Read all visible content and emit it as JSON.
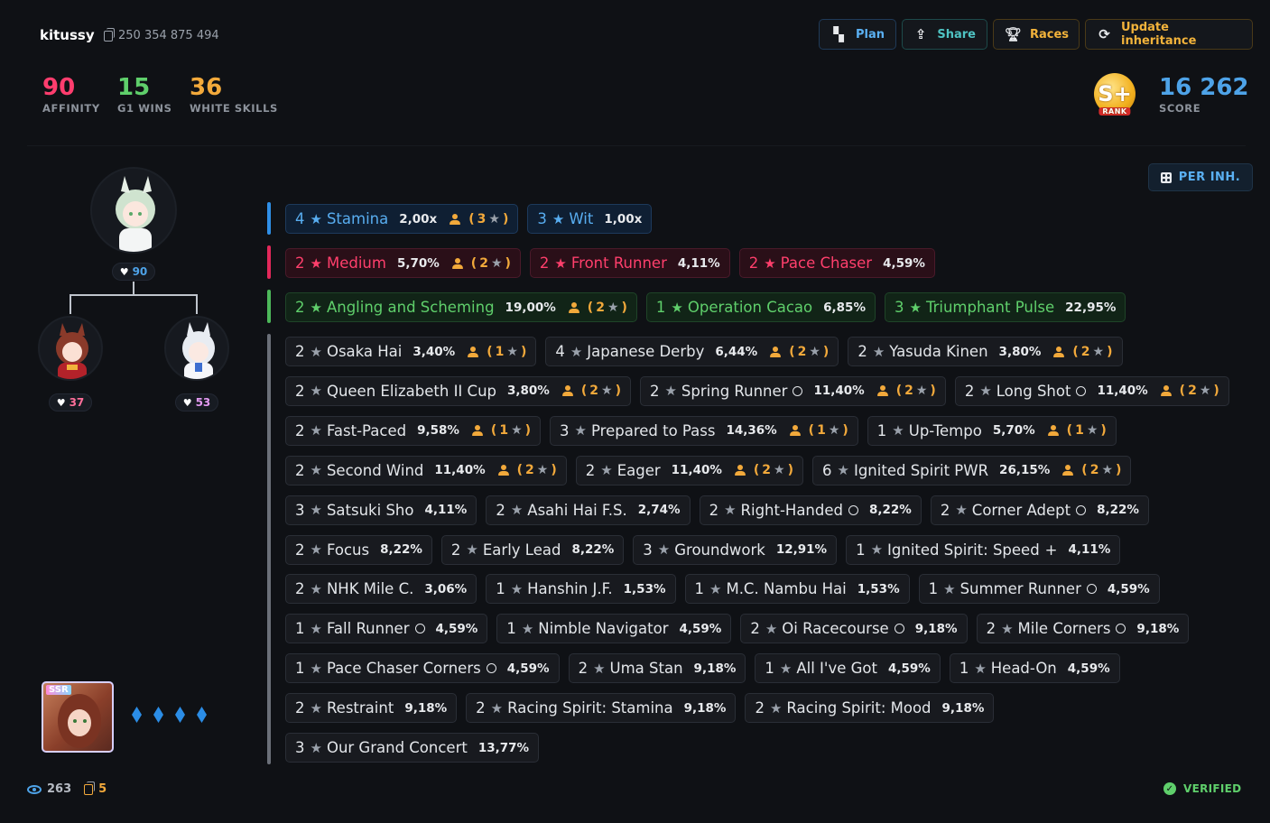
{
  "profile": {
    "username": "kitussy",
    "trainer_id": "250 354 875 494"
  },
  "stats": {
    "affinity": {
      "value": "90",
      "label": "AFFINITY",
      "color": "#ff3d6e"
    },
    "g1_wins": {
      "value": "15",
      "label": "G1 WINS",
      "color": "#5fcf6b"
    },
    "white_skills": {
      "value": "36",
      "label": "WHITE SKILLS",
      "color": "#f2a93b"
    }
  },
  "toolbar": {
    "plan": "Plan",
    "share": "Share",
    "races": "Races",
    "update": "Update inheritance"
  },
  "rank": {
    "grade": "S+",
    "badge_text": "RANK"
  },
  "score": {
    "value": "16 262",
    "label": "SCORE"
  },
  "per_inh": "PER INH.",
  "tree": {
    "main_affinity": "90",
    "parent_left_affinity": "37",
    "parent_right_affinity": "53"
  },
  "support_card": {
    "rarity": "SSR",
    "limit_break_count": 4
  },
  "footer": {
    "views": "263",
    "copies": "5",
    "verified": "VERIFIED"
  },
  "sparks": {
    "blue": [
      {
        "level": "4",
        "name": "Stamina",
        "pct": "2,00x",
        "parent": "3"
      },
      {
        "level": "3",
        "name": "Wit",
        "pct": "1,00x"
      }
    ],
    "pink": [
      {
        "level": "2",
        "name": "Medium",
        "pct": "5,70%",
        "parent": "2"
      },
      {
        "level": "2",
        "name": "Front Runner",
        "pct": "4,11%"
      },
      {
        "level": "2",
        "name": "Pace Chaser",
        "pct": "4,59%"
      }
    ],
    "green": [
      {
        "level": "2",
        "name": "Angling and Scheming",
        "pct": "19,00%",
        "parent": "2"
      },
      {
        "level": "1",
        "name": "Operation Cacao",
        "pct": "6,85%"
      },
      {
        "level": "3",
        "name": "Triumphant Pulse",
        "pct": "22,95%"
      }
    ],
    "white_rows": [
      [
        {
          "level": "2",
          "name": "Osaka Hai",
          "pct": "3,40%",
          "parent": "1"
        },
        {
          "level": "4",
          "name": "Japanese Derby",
          "pct": "6,44%",
          "parent": "2"
        },
        {
          "level": "2",
          "name": "Yasuda Kinen",
          "pct": "3,80%",
          "parent": "2"
        }
      ],
      [
        {
          "level": "2",
          "name": "Queen Elizabeth II Cup",
          "pct": "3,80%",
          "parent": "2"
        },
        {
          "level": "2",
          "name": "Spring Runner",
          "suffix": "circle",
          "pct": "11,40%",
          "parent": "2"
        },
        {
          "level": "2",
          "name": "Long Shot",
          "suffix": "circle",
          "pct": "11,40%",
          "parent": "2"
        }
      ],
      [
        {
          "level": "2",
          "name": "Fast-Paced",
          "pct": "9,58%",
          "parent": "1"
        },
        {
          "level": "3",
          "name": "Prepared to Pass",
          "pct": "14,36%",
          "parent": "1"
        },
        {
          "level": "1",
          "name": "Up-Tempo",
          "pct": "5,70%",
          "parent": "1"
        }
      ],
      [
        {
          "level": "2",
          "name": "Second Wind",
          "pct": "11,40%",
          "parent": "2"
        },
        {
          "level": "2",
          "name": "Eager",
          "pct": "11,40%",
          "parent": "2"
        },
        {
          "level": "6",
          "name": "Ignited Spirit PWR",
          "pct": "26,15%",
          "parent": "2"
        }
      ],
      [
        {
          "level": "3",
          "name": "Satsuki Sho",
          "pct": "4,11%"
        },
        {
          "level": "2",
          "name": "Asahi Hai F.S.",
          "pct": "2,74%"
        },
        {
          "level": "2",
          "name": "Right-Handed",
          "suffix": "circle",
          "pct": "8,22%"
        },
        {
          "level": "2",
          "name": "Corner Adept",
          "suffix": "circle",
          "pct": "8,22%"
        }
      ],
      [
        {
          "level": "2",
          "name": "Focus",
          "pct": "8,22%"
        },
        {
          "level": "2",
          "name": "Early Lead",
          "pct": "8,22%"
        },
        {
          "level": "3",
          "name": "Groundwork",
          "pct": "12,91%"
        },
        {
          "level": "1",
          "name": "Ignited Spirit: Speed",
          "suffix": "plus",
          "pct": "4,11%"
        }
      ],
      [
        {
          "level": "2",
          "name": "NHK Mile C.",
          "pct": "3,06%"
        },
        {
          "level": "1",
          "name": "Hanshin J.F.",
          "pct": "1,53%"
        },
        {
          "level": "1",
          "name": "M.C. Nambu Hai",
          "pct": "1,53%"
        },
        {
          "level": "1",
          "name": "Summer Runner",
          "suffix": "circle",
          "pct": "4,59%"
        }
      ],
      [
        {
          "level": "1",
          "name": "Fall Runner",
          "suffix": "circle",
          "pct": "4,59%"
        },
        {
          "level": "1",
          "name": "Nimble Navigator",
          "pct": "4,59%"
        },
        {
          "level": "2",
          "name": "Oi Racecourse",
          "suffix": "circle",
          "pct": "9,18%"
        },
        {
          "level": "2",
          "name": "Mile Corners",
          "suffix": "circle",
          "pct": "9,18%"
        }
      ],
      [
        {
          "level": "1",
          "name": "Pace Chaser Corners",
          "suffix": "circle",
          "pct": "4,59%"
        },
        {
          "level": "2",
          "name": "Uma Stan",
          "pct": "9,18%"
        },
        {
          "level": "1",
          "name": "All I've Got",
          "pct": "4,59%"
        },
        {
          "level": "1",
          "name": "Head-On",
          "pct": "4,59%"
        }
      ],
      [
        {
          "level": "2",
          "name": "Restraint",
          "pct": "9,18%"
        },
        {
          "level": "2",
          "name": "Racing Spirit: Stamina",
          "pct": "9,18%"
        },
        {
          "level": "2",
          "name": "Racing Spirit: Mood",
          "pct": "9,18%"
        }
      ],
      [
        {
          "level": "3",
          "name": "Our Grand Concert",
          "pct": "13,77%"
        }
      ]
    ]
  }
}
